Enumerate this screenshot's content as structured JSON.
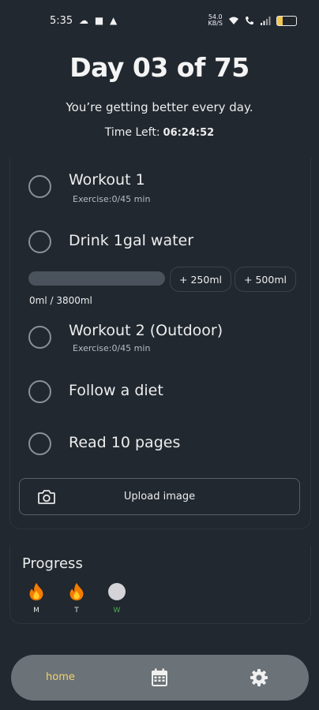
{
  "status_bar": {
    "time": "5:35",
    "left_icons": "☁ ■ ▲",
    "net_top": "54.0",
    "net_bottom": "KB/S",
    "battery": "31"
  },
  "header": {
    "title": "Day 03 of 75",
    "motto": "You’re getting better every day.",
    "time_left_label": "Time Left:",
    "time_left_value": "06:24:52"
  },
  "tasks": [
    {
      "label": "Workout 1",
      "sub": "Exercise:0/45 min"
    },
    {
      "label": "Drink 1gal water",
      "sub": ""
    },
    {
      "label": "Workout 2 (Outdoor)",
      "sub": "Exercise:0/45 min"
    },
    {
      "label": "Follow a diet",
      "sub": ""
    },
    {
      "label": "Read 10 pages",
      "sub": ""
    }
  ],
  "water": {
    "add_250": "+ 250ml",
    "add_500": "+ 500ml",
    "count": "0ml / 3800ml",
    "progress": 0
  },
  "upload": {
    "label": "Upload image",
    "icon": "camera-icon"
  },
  "progress": {
    "title": "Progress",
    "days": [
      {
        "letter": "M",
        "state": "done",
        "icon": "fire-icon",
        "letter_color": "#e6e6e6"
      },
      {
        "letter": "T",
        "state": "done",
        "icon": "fire-icon",
        "letter_color": "#e6e6e6"
      },
      {
        "letter": "W",
        "state": "pending",
        "icon": "circle-icon",
        "letter_color": "#4caf50"
      }
    ]
  },
  "nav": {
    "home_label": "home",
    "calendar_icon": "calendar-icon",
    "settings_icon": "gear-icon"
  },
  "colors": {
    "background": "#212830",
    "nav_bar": "#6b7278",
    "home_accent": "#f2d36b",
    "today_accent": "#4caf50"
  }
}
